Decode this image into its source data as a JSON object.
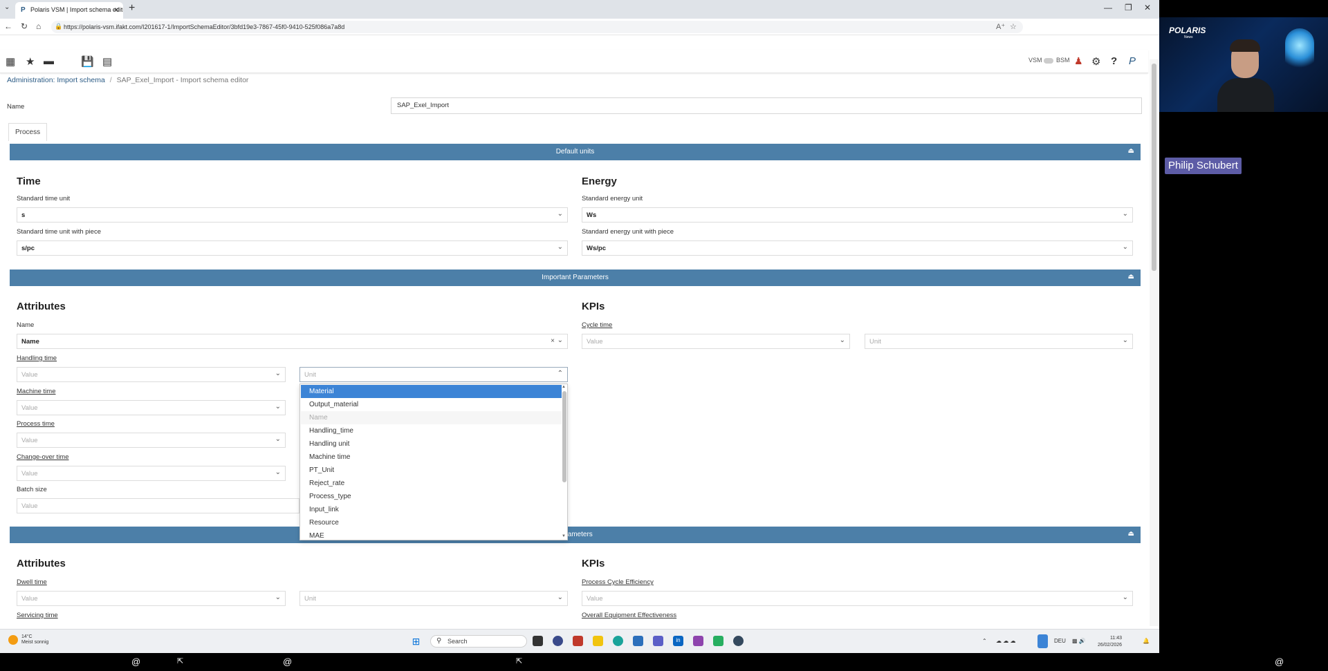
{
  "browser": {
    "tab_title": "Polaris VSM | Import schema edito",
    "url": "https://polaris-vsm.ifakt.com/I201617-1/ImportSchemaEditor/3bfd19e3-7867-45f0-9410-525f086a7a8d"
  },
  "toolbar": {
    "vsm_label": "VSM",
    "bsm_label": "BSM",
    "notification_count": "0"
  },
  "breadcrumb": {
    "parent": "Administration: Import schema",
    "separator": "/",
    "current": "SAP_Exel_Import - Import schema editor"
  },
  "form": {
    "name_label": "Name",
    "name_value": "SAP_Exel_Import",
    "tab_process": "Process"
  },
  "default_units": {
    "band_title": "Default units",
    "time_heading": "Time",
    "std_time_unit_label": "Standard time unit",
    "std_time_unit_value": "s",
    "std_time_unit_piece_label": "Standard time unit with piece",
    "std_time_unit_piece_value": "s/pc",
    "energy_heading": "Energy",
    "std_energy_unit_label": "Standard energy unit",
    "std_energy_unit_value": "Ws",
    "std_energy_unit_piece_label": "Standard energy unit with piece",
    "std_energy_unit_piece_value": "Ws/pc"
  },
  "important_parameters": {
    "band_title": "Important Parameters",
    "attributes_heading": "Attributes",
    "name_label": "Name",
    "name_value": "Name",
    "handling_time_label": "Handling time",
    "machine_time_label": "Machine time",
    "process_time_label": "Process time",
    "changeover_time_label": "Change-over time",
    "batch_size_label": "Batch size",
    "value_placeholder": "Value",
    "unit_placeholder": "Unit",
    "kpis_heading": "KPIs",
    "cycle_time_label": "Cycle time"
  },
  "dropdown": {
    "items": [
      {
        "label": "Material",
        "state": "selected"
      },
      {
        "label": "Output_material",
        "state": "normal"
      },
      {
        "label": "Name",
        "state": "disabled"
      },
      {
        "label": "Handling_time",
        "state": "normal"
      },
      {
        "label": "Handling unit",
        "state": "normal"
      },
      {
        "label": "Machine time",
        "state": "normal"
      },
      {
        "label": "PT_Unit",
        "state": "normal"
      },
      {
        "label": "Reject_rate",
        "state": "normal"
      },
      {
        "label": "Process_type",
        "state": "normal"
      },
      {
        "label": "Input_link",
        "state": "normal"
      },
      {
        "label": "Resource",
        "state": "normal"
      },
      {
        "label": "MAE",
        "state": "normal"
      }
    ]
  },
  "further_parameters": {
    "band_title": "parameters",
    "attributes_heading": "Attributes",
    "dwell_time_label": "Dwell time",
    "servicing_time_label": "Servicing time",
    "kpis_heading": "KPIs",
    "pce_label": "Process Cycle Efficiency",
    "oee_label": "Overall Equipment Effectiveness"
  },
  "taskbar": {
    "weather_temp": "14°C",
    "weather_desc": "Meist sonnig",
    "search_label": "Search",
    "language": "DEU",
    "time": "11:43",
    "date": "26/02/2026"
  },
  "video": {
    "logo": "POLARIS",
    "logo_sub": "News",
    "participant_name": "Philip Schubert"
  },
  "colors": {
    "band": "#4c7fa8",
    "selection": "#3c84d6",
    "nameplate": "#5d5ca6"
  }
}
